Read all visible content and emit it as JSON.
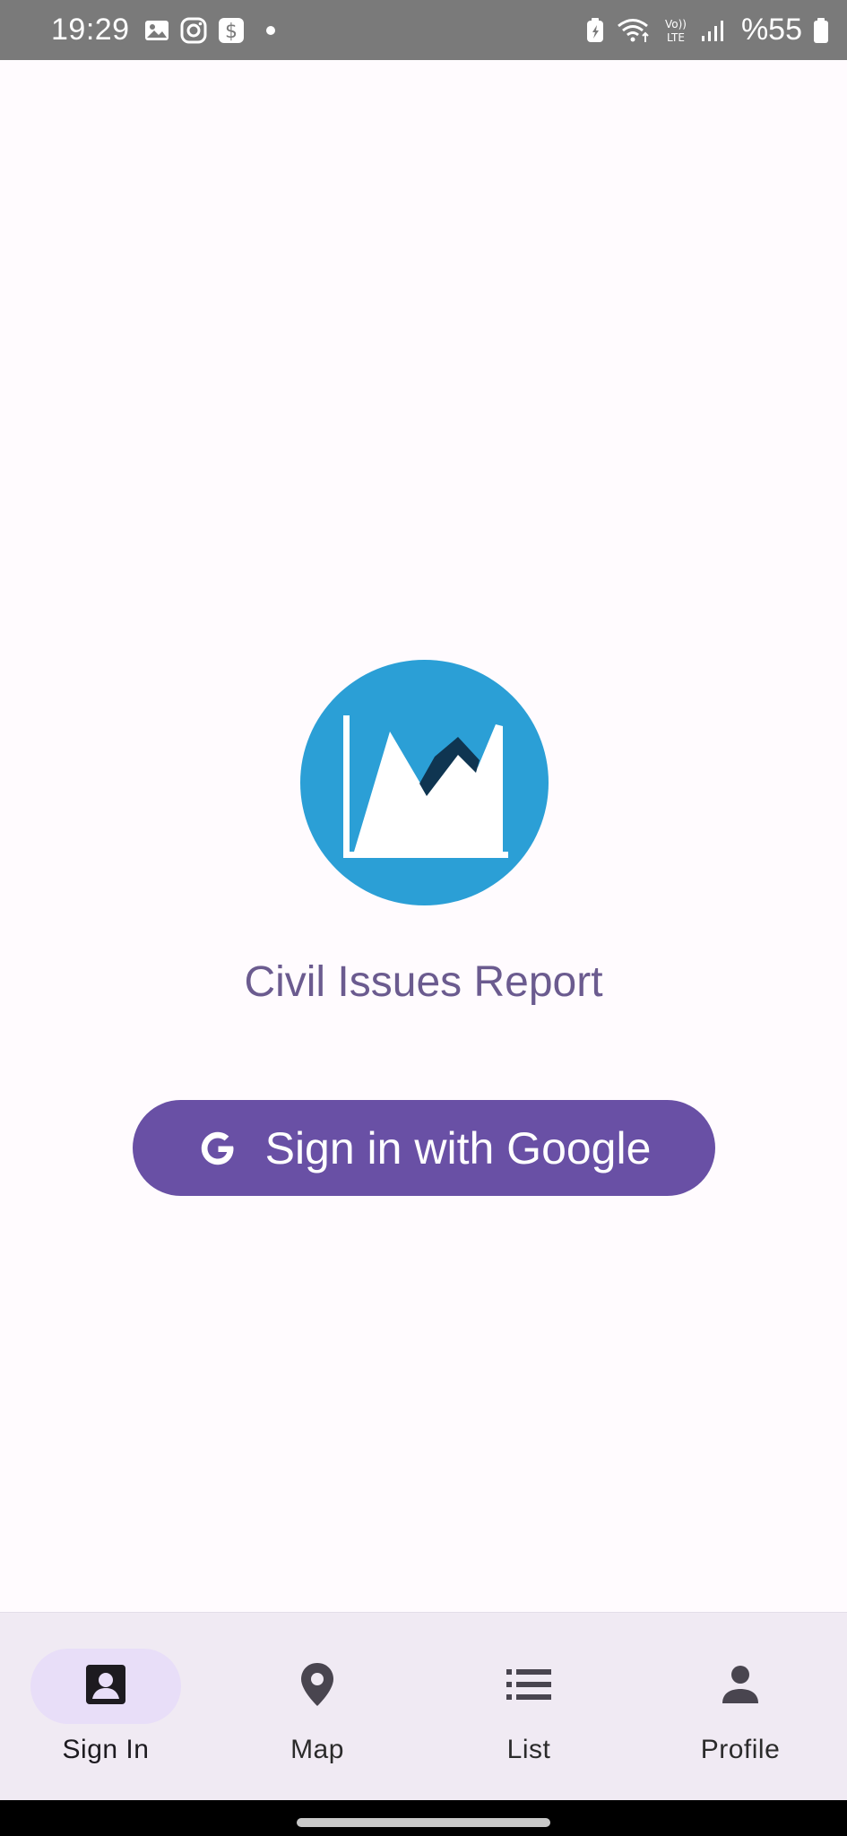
{
  "status_bar": {
    "time": "19:29",
    "battery_text": "%55",
    "left_icons": [
      "gallery-icon",
      "instagram-icon",
      "dollar-app-icon",
      "dot-icon"
    ],
    "right_icons": [
      "battery-saver-icon",
      "wifi-icon",
      "volte-icon",
      "signal-icon",
      "battery-icon"
    ],
    "volte_label": "Vo)) LTE"
  },
  "app": {
    "title": "Civil Issues Report",
    "logo_icon": "area-chart-logo-icon",
    "colors": {
      "logo_circle": "#2b9fd6",
      "logo_dark": "#0f3551",
      "title": "#6b5b8f",
      "primary": "#6950a5"
    }
  },
  "sign_in_button": {
    "label": "Sign in with Google",
    "icon": "google-icon"
  },
  "bottom_nav": {
    "items": [
      {
        "label": "Sign In",
        "icon": "account-box-icon",
        "active": true
      },
      {
        "label": "Map",
        "icon": "map-pin-icon",
        "active": false
      },
      {
        "label": "List",
        "icon": "list-icon",
        "active": false
      },
      {
        "label": "Profile",
        "icon": "person-icon",
        "active": false
      }
    ]
  }
}
